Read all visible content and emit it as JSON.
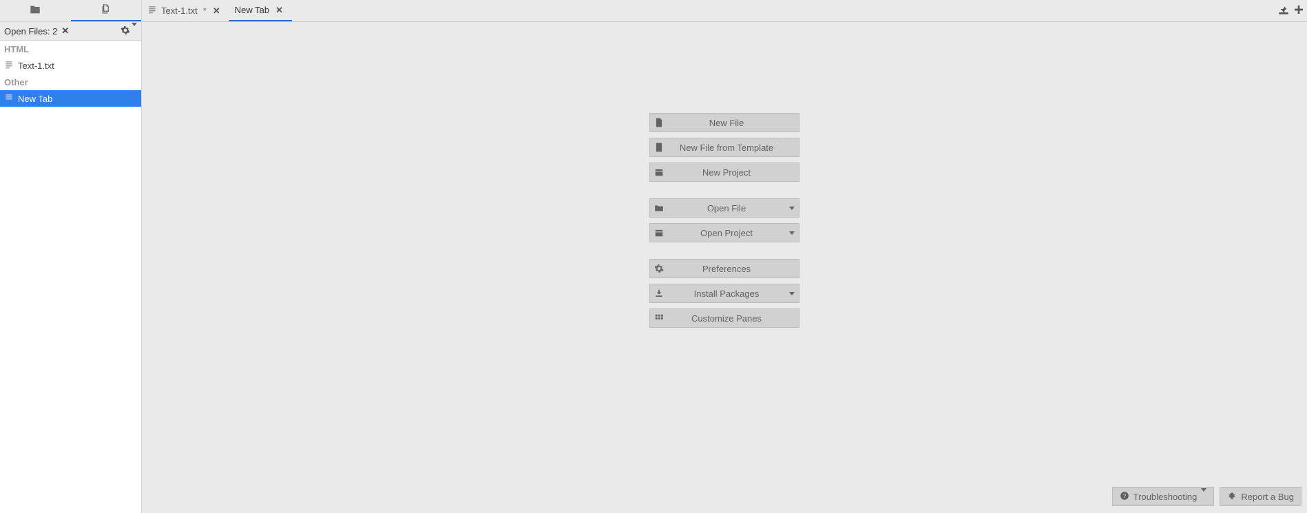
{
  "sidebar": {
    "open_files_label": "Open Files: 2",
    "groups": [
      {
        "label": "HTML",
        "items": [
          {
            "name": "Text-1.txt"
          }
        ]
      },
      {
        "label": "Other",
        "items": [
          {
            "name": "New Tab",
            "selected": true
          }
        ]
      }
    ]
  },
  "tabs": [
    {
      "name": "Text-1.txt",
      "modified": "*",
      "active": false
    },
    {
      "name": "New Tab",
      "modified": "",
      "active": true
    }
  ],
  "welcome": {
    "group1": {
      "new_file": "New File",
      "new_file_template": "New File from Template",
      "new_project": "New Project"
    },
    "group2": {
      "open_file": "Open File",
      "open_project": "Open Project"
    },
    "group3": {
      "preferences": "Preferences",
      "install_packages": "Install Packages",
      "customize_panes": "Customize Panes"
    }
  },
  "status": {
    "troubleshooting": "Troubleshooting",
    "report_bug": "Report a Bug"
  }
}
